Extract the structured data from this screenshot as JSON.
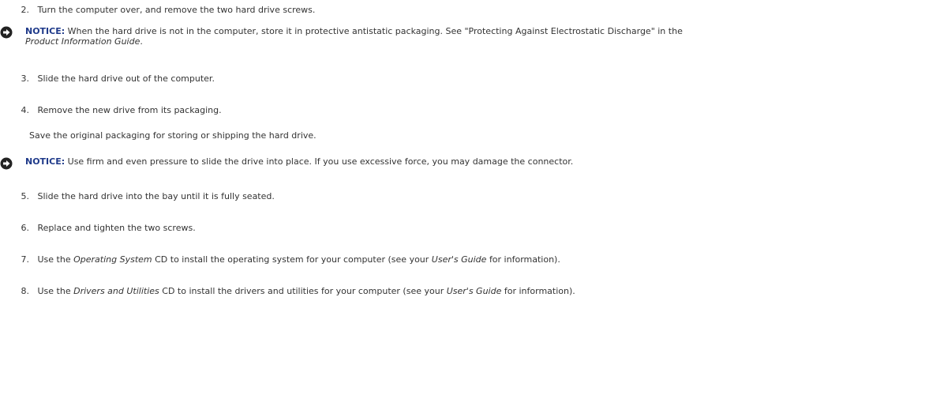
{
  "steps": [
    {
      "num": "2.",
      "text": "Turn the computer over, and remove the two hard drive screws."
    },
    {
      "num": "3.",
      "text": "Slide the hard drive out of the computer."
    },
    {
      "num": "4.",
      "text": "Remove the new drive from its packaging."
    },
    {
      "num": "5.",
      "text": "Slide the hard drive into the bay until it is fully seated."
    },
    {
      "num": "6.",
      "text": "Replace and tighten the two screws."
    },
    {
      "num": "7.",
      "pre": "Use the",
      "em": "Operating System",
      "mid": "CD to install the operating system for your computer (see your",
      "em2": "User's Guide",
      "post": "for information)."
    },
    {
      "num": "8.",
      "pre": "Use the",
      "em": "Drivers and Utilities",
      "mid": "CD to install the drivers and utilities for your computer (see your",
      "em2": "User's Guide",
      "post": "for information)."
    }
  ],
  "step4_para": "Save the original packaging for storing or shipping the hard drive.",
  "notices": [
    {
      "label": "NOTICE:",
      "text": "When the hard drive is not in the computer, store it in protective antistatic packaging. See \"Protecting Against Electrostatic Discharge\" in the",
      "em": "Product Information Guide",
      "post": "."
    },
    {
      "label": "NOTICE:",
      "text": "Use firm and even pressure to slide the drive into place. If you use excessive force, you may damage the connector."
    }
  ],
  "icon_name": "notice-arrow-icon"
}
